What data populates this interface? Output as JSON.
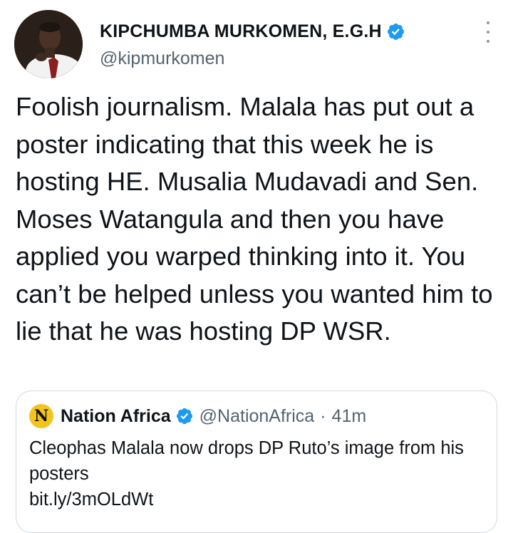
{
  "author": {
    "display_name": "KIPCHUMBA MURKOMEN, E.G.H",
    "handle": "@kipmurkomen",
    "verified_icon": "verified-badge-icon",
    "avatar_icon": "profile-photo"
  },
  "tweet": {
    "text": "Foolish journalism. Malala has put out a poster indicating that this week he is hosting HE. Musalia Mudavadi and Sen. Moses Watangula and then you have applied you warped thinking into it. You can’t be helped unless you wanted him to lie that he was hosting DP WSR."
  },
  "more_icon": "more-options-icon",
  "quote": {
    "avatar_letter": "N",
    "name": "Nation Africa",
    "handle": "@NationAfrica",
    "separator": "·",
    "time": "41m",
    "text": "Cleophas Malala now drops DP Ruto’s image from his posters",
    "link": "bit.ly/3mOLdWt"
  },
  "colors": {
    "verified_blue": "#1d9bf0",
    "secondary_text": "#536471",
    "border": "#cfd9de",
    "nation_yellow": "#f3c41c"
  }
}
